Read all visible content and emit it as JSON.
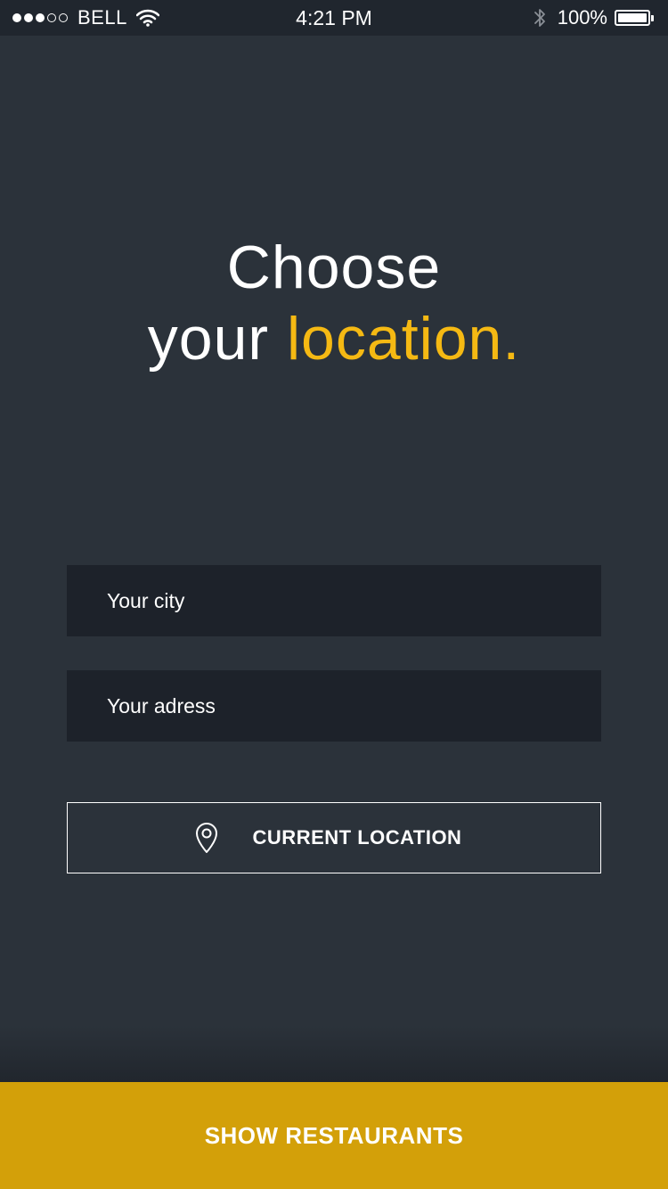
{
  "status_bar": {
    "signal_filled": 3,
    "signal_total": 5,
    "carrier": "BELL",
    "time": "4:21 PM",
    "battery": "100%",
    "icons": [
      "wifi-icon",
      "bluetooth-icon",
      "battery-icon"
    ]
  },
  "heading": {
    "line1": "Choose",
    "line2_prefix": "your",
    "line2_accent": "location."
  },
  "form": {
    "city_placeholder": "Your city",
    "city_value": "",
    "address_placeholder": "Your adress",
    "address_value": ""
  },
  "current_location": {
    "icon": "location-pin-icon",
    "label": "CURRENT LOCATION"
  },
  "cta": {
    "label": "SHOW RESTAURANTS"
  },
  "colors": {
    "background": "#2b323a",
    "status_bar": "#20262e",
    "input_background": "#1d222a",
    "accent": "#f5b913",
    "cta_background": "#d3a009"
  }
}
